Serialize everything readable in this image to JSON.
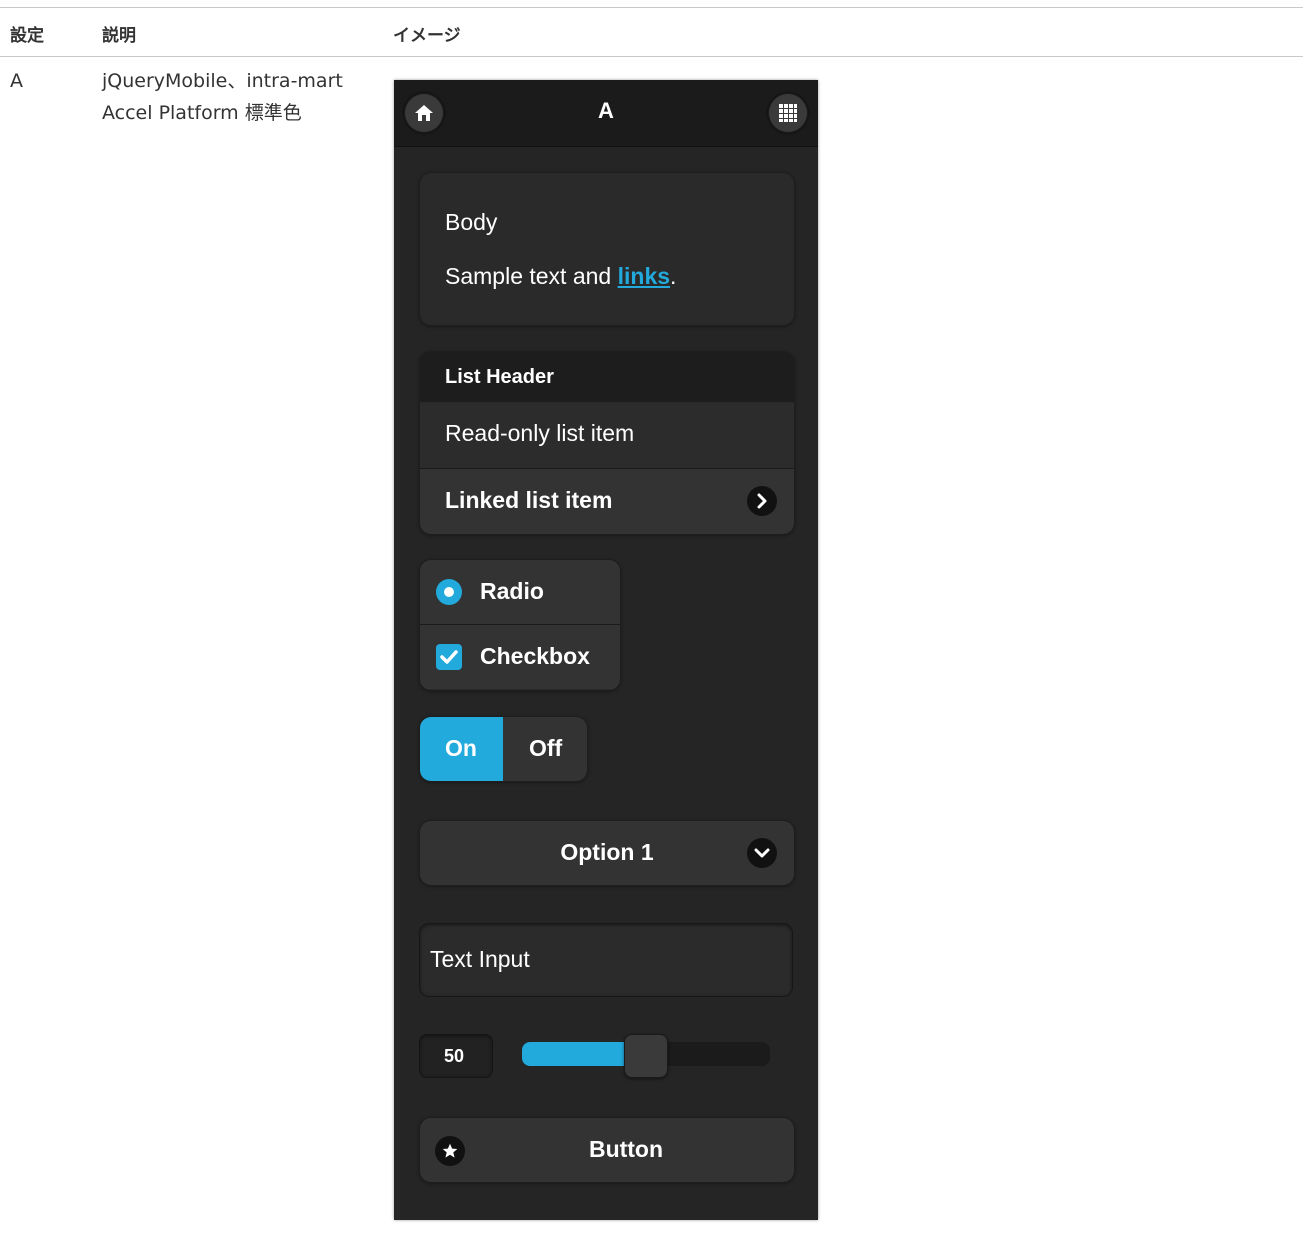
{
  "table": {
    "headers": [
      "設定",
      "説明",
      "イメージ"
    ],
    "row": {
      "setting": "A",
      "description_line1": "jQueryMobile、intra-mart",
      "description_line2": "Accel Platform 標準色"
    }
  },
  "preview": {
    "header_title": "A",
    "body_title": "Body",
    "body_text_before": "Sample text and ",
    "body_link": "links",
    "body_text_after": ".",
    "list_header": "List Header",
    "list_readonly": "Read-only list item",
    "list_linked": "Linked list item",
    "radio_label": "Radio",
    "checkbox_label": "Checkbox",
    "flip_on": "On",
    "flip_off": "Off",
    "select_value": "Option 1",
    "text_input_value": "Text Input",
    "slider_value": "50",
    "slider_fraction": 0.5,
    "button_label": "Button",
    "accent_color": "#22aadd",
    "icons": [
      "home-icon",
      "grid-icon",
      "chevron-right-icon",
      "chevron-down-icon",
      "star-icon"
    ]
  }
}
